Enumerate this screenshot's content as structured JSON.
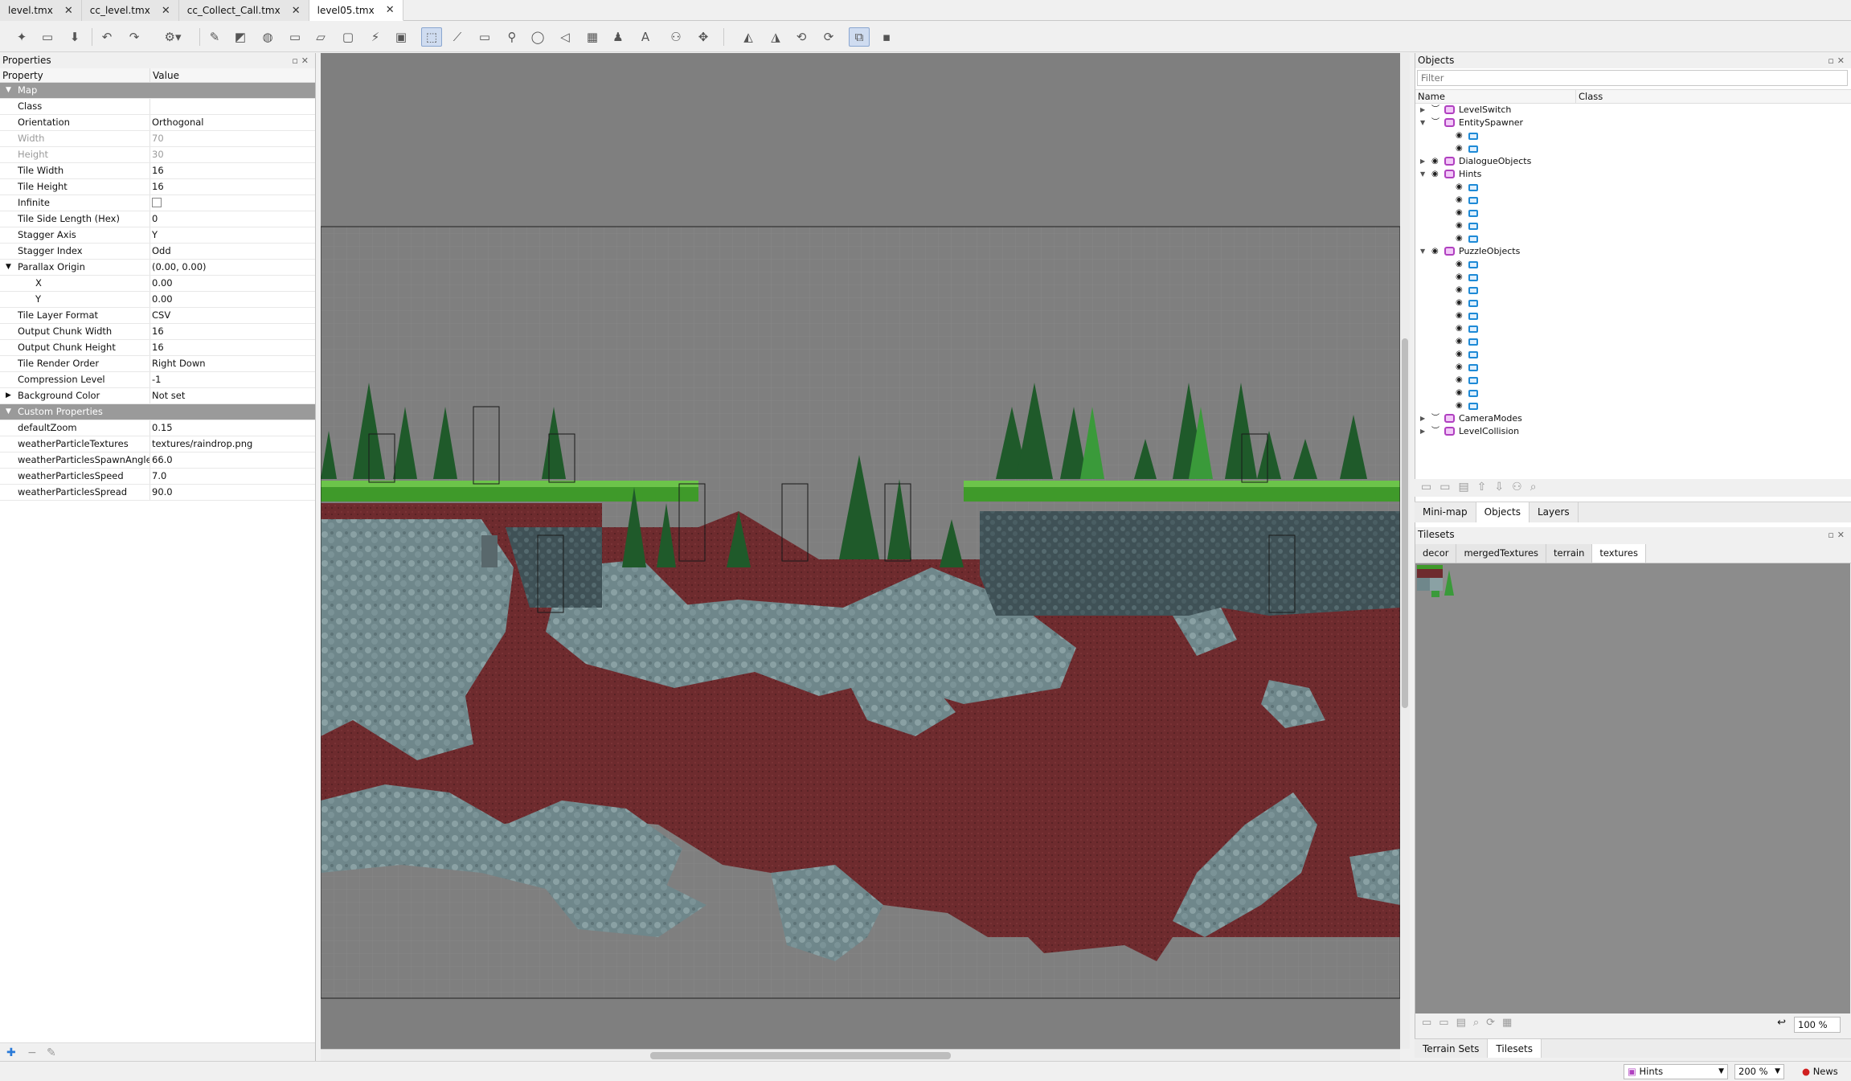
{
  "tabs": [
    {
      "label": "level.tmx"
    },
    {
      "label": "cc_level.tmx"
    },
    {
      "label": "cc_Collect_Call.tmx"
    },
    {
      "label": "level05.tmx",
      "active": true
    }
  ],
  "properties": {
    "title": "Properties",
    "col_property": "Property",
    "col_value": "Value",
    "map_group": "Map",
    "rows": [
      {
        "k": "Class",
        "v": ""
      },
      {
        "k": "Orientation",
        "v": "Orthogonal"
      },
      {
        "k": "Width",
        "v": "70",
        "disabled": true
      },
      {
        "k": "Height",
        "v": "30",
        "disabled": true
      },
      {
        "k": "Tile Width",
        "v": "16"
      },
      {
        "k": "Tile Height",
        "v": "16"
      },
      {
        "k": "Infinite",
        "v": "",
        "checkbox": true
      },
      {
        "k": "Tile Side Length (Hex)",
        "v": "0"
      },
      {
        "k": "Stagger Axis",
        "v": "Y"
      },
      {
        "k": "Stagger Index",
        "v": "Odd"
      },
      {
        "k": "Parallax Origin",
        "v": "(0.00, 0.00)",
        "expanded": true
      },
      {
        "k": "X",
        "v": "0.00",
        "sub": true
      },
      {
        "k": "Y",
        "v": "0.00",
        "sub": true
      },
      {
        "k": "Tile Layer Format",
        "v": "CSV"
      },
      {
        "k": "Output Chunk Width",
        "v": "16"
      },
      {
        "k": "Output Chunk Height",
        "v": "16"
      },
      {
        "k": "Tile Render Order",
        "v": "Right Down"
      },
      {
        "k": "Compression Level",
        "v": "-1"
      },
      {
        "k": "Background Color",
        "v": "Not set",
        "collapsed": true
      }
    ],
    "custom_group": "Custom Properties",
    "custom_rows": [
      {
        "k": "defaultZoom",
        "v": "0.15"
      },
      {
        "k": "weatherParticleTextures",
        "v": "textures/raindrop.png"
      },
      {
        "k": "weatherParticlesSpawnAngle",
        "v": "66.0"
      },
      {
        "k": "weatherParticlesSpeed",
        "v": "7.0"
      },
      {
        "k": "weatherParticlesSpread",
        "v": "90.0"
      }
    ]
  },
  "objects": {
    "title": "Objects",
    "filter_placeholder": "Filter",
    "col_name": "Name",
    "col_class": "Class",
    "layers": [
      {
        "name": "LevelSwitch",
        "expanded": false,
        "visible": false,
        "children": 0
      },
      {
        "name": "EntitySpawner",
        "expanded": true,
        "visible": false,
        "children": 2
      },
      {
        "name": "DialogueObjects",
        "expanded": false,
        "visible": true,
        "children": 0
      },
      {
        "name": "Hints",
        "expanded": true,
        "visible": true,
        "children": 5
      },
      {
        "name": "PuzzleObjects",
        "expanded": true,
        "visible": true,
        "children": 12
      },
      {
        "name": "CameraModes",
        "expanded": false,
        "visible": false,
        "children": 0
      },
      {
        "name": "LevelCollision",
        "expanded": false,
        "visible": false,
        "children": 0
      }
    ]
  },
  "dock_tabs": [
    {
      "label": "Mini-map"
    },
    {
      "label": "Objects",
      "active": true
    },
    {
      "label": "Layers"
    }
  ],
  "tilesets": {
    "title": "Tilesets",
    "tabs": [
      {
        "label": "decor"
      },
      {
        "label": "mergedTextures"
      },
      {
        "label": "terrain"
      },
      {
        "label": "textures",
        "active": true
      }
    ],
    "zoom": "100 %"
  },
  "bottom_tabs": [
    {
      "label": "Terrain Sets"
    },
    {
      "label": "Tilesets",
      "active": true
    }
  ],
  "status": {
    "layer": "Hints",
    "zoom": "200 %",
    "news": "News"
  },
  "colors": {
    "canvas_bg": "#7f7f7f",
    "dirt": "#6b2a2c",
    "stone": "#6b8488",
    "grass": "#3f9a2a",
    "tree": "#1f5a2a",
    "group_icon": "#b040c0",
    "object_icon": "#1e8ad6"
  }
}
